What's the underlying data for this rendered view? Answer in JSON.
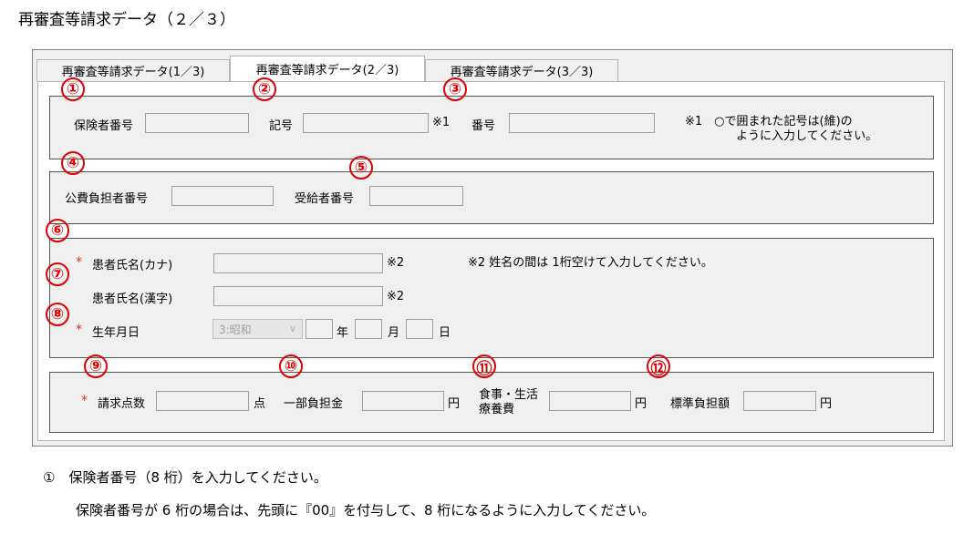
{
  "doc_title": "再審査等請求データ（２／３）",
  "tabs": [
    {
      "label": "再審査等請求データ(1／3)"
    },
    {
      "label": "再審査等請求データ(2／3)"
    },
    {
      "label": "再審査等請求データ(3／3)"
    }
  ],
  "markers": [
    "①",
    "②",
    "③",
    "④",
    "⑤",
    "⑥",
    "⑦",
    "⑧",
    "⑨",
    "⑩",
    "⑪",
    "⑫"
  ],
  "group1": {
    "insurer_label": "保険者番号",
    "symbol_label": "記号",
    "symbol_note": "※1",
    "number_label": "番号",
    "note1": "※1　○で囲まれた記号は(維)の",
    "note2": "ように入力してください。"
  },
  "group2": {
    "public_payer_label": "公費負担者番号",
    "recipient_label": "受給者番号"
  },
  "group3": {
    "req_mark": "*",
    "kana_label": "患者氏名(カナ)",
    "kana_note": "※2",
    "kana_hint": "※2 姓名の間は 1桁空けて入力してください。",
    "kanji_label": "患者氏名(漢字)",
    "kanji_note": "※2",
    "dob_label": "生年月日",
    "era_value": "3:昭和",
    "year_label": "年",
    "month_label": "月",
    "day_label": "日"
  },
  "group4": {
    "req_mark": "*",
    "points_label": "請求点数",
    "points_unit": "点",
    "copay_label": "一部負担金",
    "copay_unit": "円",
    "meal_label1": "食事・生活",
    "meal_label2": "療養費",
    "meal_unit": "円",
    "standard_label": "標準負担額",
    "standard_unit": "円"
  },
  "instructions": {
    "line1": "①　保険者番号（8 桁）を入力してください。",
    "line2": "保険者番号が 6 桁の場合は、先頭に『00』を付与して、8 桁になるように入力してください。"
  }
}
